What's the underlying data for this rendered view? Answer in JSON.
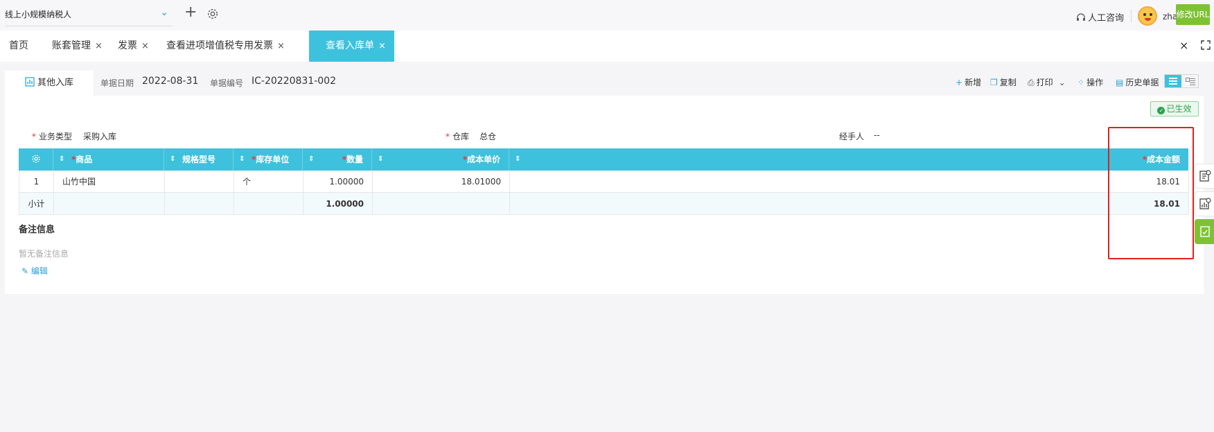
{
  "header": {
    "company_name": "线上小规模纳税人",
    "consult_label": "人工咨询",
    "username": "zha",
    "modify_url_label": "修改URL"
  },
  "tabs": [
    {
      "label": "首页",
      "closable": false
    },
    {
      "label": "账套管理",
      "closable": true
    },
    {
      "label": "发票",
      "closable": true
    },
    {
      "label": "查看进项增值税专用发票",
      "closable": true
    },
    {
      "label": "查看入库单",
      "closable": true,
      "active": true
    }
  ],
  "close_glyph": "×",
  "document": {
    "subtab_label": "其他入库",
    "date_label": "单据日期",
    "date_value": "2022-08-31",
    "number_label": "单据编号",
    "number_value": "IC-20220831-002",
    "status": "已生效"
  },
  "toolbar": {
    "new_label": "新增",
    "copy_label": "复制",
    "print_label": "打印",
    "operate_label": "操作",
    "history_label": "历史单据"
  },
  "fields": {
    "biz_type_label": "业务类型",
    "biz_type_value": "采购入库",
    "warehouse_label": "仓库",
    "warehouse_value": "总仓",
    "handler_label": "经手人",
    "handler_value": "--"
  },
  "table": {
    "columns": {
      "product": "商品",
      "spec": "规格型号",
      "unit": "库存单位",
      "qty": "数量",
      "unit_cost": "成本单价",
      "cost_amount": "成本金额"
    },
    "rows": [
      {
        "index": "1",
        "product": "山竹中国",
        "spec": "",
        "unit": "个",
        "qty": "1.00000",
        "unit_cost": "18.01000",
        "cost_amount": "18.01"
      }
    ],
    "subtotal": {
      "label": "小计",
      "qty": "1.00000",
      "cost_amount": "18.01"
    }
  },
  "remark": {
    "title": "备注信息",
    "empty_text": "暂无备注信息",
    "edit_label": "编辑"
  },
  "colors": {
    "accent": "#3ec1dc",
    "green": "#7ec233",
    "required": "#e33333",
    "highlight": "#e02020"
  }
}
